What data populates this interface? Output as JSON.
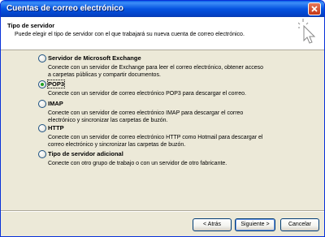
{
  "window": {
    "title": "Cuentas de correo electrónico"
  },
  "header": {
    "title": "Tipo de servidor",
    "description": "Puede elegir el tipo de servidor con el que trabajará su nueva cuenta de correo electrónico."
  },
  "options": [
    {
      "label": "Servidor de Microsoft Exchange",
      "selected": false,
      "description": "Conecte con un servidor de Exchange para leer el correo electrónico, obtener acceso a carpetas públicas y compartir documentos."
    },
    {
      "label": "POP3",
      "selected": true,
      "description": "Conecte con un servidor de correo electrónico POP3 para descargar el correo."
    },
    {
      "label": "IMAP",
      "selected": false,
      "description": "Conecte con un servidor de correo electrónico IMAP para descargar el correo electrónico y sincronizar las carpetas de buzón."
    },
    {
      "label": "HTTP",
      "selected": false,
      "description": "Conecte con un servidor de correo electrónico HTTP como Hotmail para descargar el correo electrónico y sincronizar las carpetas de buzón."
    },
    {
      "label": "Tipo de servidor adicional",
      "selected": false,
      "description": "Conecte con otro grupo de trabajo o con un servidor de otro fabricante."
    }
  ],
  "buttons": {
    "back": "< Atrás",
    "next": "Siguiente >",
    "cancel": "Cancelar"
  },
  "colors": {
    "titlebar": "#0553e0",
    "selected_radio": "#21a121",
    "dialog_bg": "#ece9d8"
  }
}
